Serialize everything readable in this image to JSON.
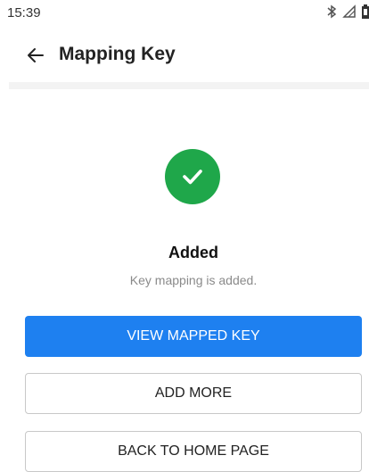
{
  "status_bar": {
    "time": "15:39",
    "icons": [
      "bluetooth-icon",
      "signal-icon",
      "battery-icon"
    ]
  },
  "app_bar": {
    "back_icon": "arrow-left-icon",
    "title": "Mapping Key"
  },
  "result": {
    "icon": "check-circle-icon",
    "icon_color": "#1fa74a",
    "title": "Added",
    "message": "Key mapping is added."
  },
  "buttons": {
    "view_mapped_key": "VIEW MAPPED KEY",
    "add_more": "ADD MORE",
    "back_to_home": "BACK TO HOME PAGE"
  },
  "colors": {
    "primary": "#1e80f0",
    "success": "#1fa74a"
  }
}
